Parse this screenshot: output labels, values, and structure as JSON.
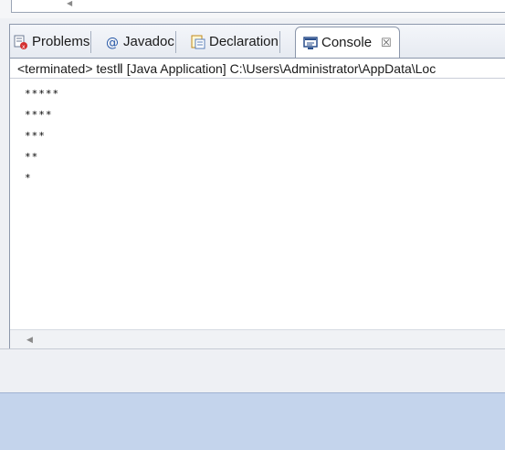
{
  "tabs": [
    {
      "label": "Problems",
      "icon": "problems-icon"
    },
    {
      "label": "Javadoc",
      "icon": "javadoc-icon"
    },
    {
      "label": "Declaration",
      "icon": "declaration-icon"
    },
    {
      "label": "Console",
      "icon": "console-icon",
      "active": true
    }
  ],
  "console": {
    "header": "<terminated> testⅡ [Java Application] C:\\Users\\Administrator\\AppData\\Loc",
    "lines": [
      "*****",
      "****",
      "***",
      "**",
      "*"
    ]
  },
  "colors": {
    "accent": "#c4d4ec",
    "border": "#8c97ab"
  }
}
